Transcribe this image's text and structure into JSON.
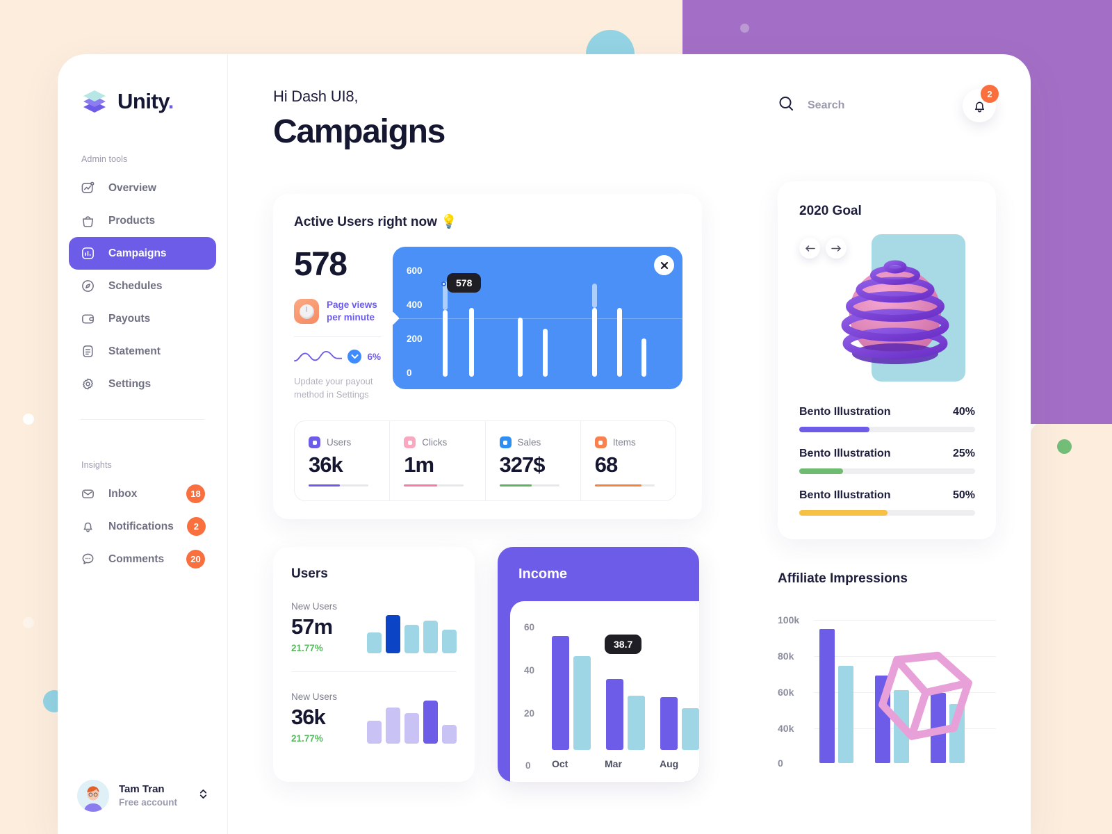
{
  "brand": {
    "name": "Unity",
    "dot": ".",
    "logo_icon": "layers-icon"
  },
  "sidebar": {
    "admin_label": "Admin tools",
    "insights_label": "Insights",
    "admin_items": [
      {
        "label": "Overview",
        "icon": "chart-square-icon"
      },
      {
        "label": "Products",
        "icon": "bag-icon"
      },
      {
        "label": "Campaigns",
        "icon": "bar-chart-icon"
      },
      {
        "label": "Schedules",
        "icon": "compass-icon"
      },
      {
        "label": "Payouts",
        "icon": "wallet-icon"
      },
      {
        "label": "Statement",
        "icon": "document-icon"
      },
      {
        "label": "Settings",
        "icon": "gear-icon"
      }
    ],
    "active_item": "Campaigns",
    "insight_items": [
      {
        "label": "Inbox",
        "icon": "envelope-icon",
        "badge": "18"
      },
      {
        "label": "Notifications",
        "icon": "bell-icon",
        "badge": "2"
      },
      {
        "label": "Comments",
        "icon": "comment-icon",
        "badge": "20"
      }
    ],
    "profile": {
      "name": "Tam Tran",
      "plan": "Free account",
      "switch_icon": "up-down-chevrons-icon"
    }
  },
  "header": {
    "greeting": "Hi Dash UI8,",
    "title": "Campaigns"
  },
  "topbar": {
    "search_placeholder": "Search",
    "search_icon": "search-icon",
    "bell_icon": "bell-icon",
    "bell_badge": "2"
  },
  "active_users": {
    "title": "Active Users right now 💡",
    "count": "578",
    "page_views_line1": "Page views",
    "page_views_line2": "per minute",
    "page_views_icon": "dial-icon",
    "trend_pct": "6%",
    "trend_icon": "chevron-down-circle-icon",
    "hint_line1": "Update your payout",
    "hint_line2": "method in Settings",
    "close_icon": "close-icon",
    "tooltip": "578"
  },
  "stats": [
    {
      "label": "Users",
      "value": "36k",
      "icon": "user-square-icon",
      "color": "#6c5ce7",
      "bar_color": "#6c5ce7",
      "bar_pct": 52
    },
    {
      "label": "Clicks",
      "value": "1m",
      "icon": "click-square-icon",
      "color": "#f9a8c0",
      "bar_color": "#f57aa4",
      "bar_pct": 55
    },
    {
      "label": "Sales",
      "value": "327$",
      "icon": "bag-square-icon",
      "color": "#2f8ff0",
      "bar_color": "#5cb35f",
      "bar_pct": 54
    },
    {
      "label": "Items",
      "value": "68",
      "icon": "box-square-icon",
      "color": "#f9804f",
      "bar_color": "#f4833f",
      "bar_pct": 78
    }
  ],
  "users_card": {
    "title": "Users",
    "blocks": [
      {
        "label": "New Users",
        "value": "57m",
        "pct": "21.77%"
      },
      {
        "label": "New Users",
        "value": "36k",
        "pct": "21.77%"
      }
    ]
  },
  "income_card": {
    "title": "Income",
    "tooltip": "38.7"
  },
  "goal_card": {
    "title": "2020 Goal",
    "prev_icon": "arrow-left-icon",
    "next_icon": "arrow-right-icon",
    "illustration_icon": "sphere-rings-3d-icon",
    "rows": [
      {
        "name": "Bento Illustration",
        "pct": "40%",
        "value": 40,
        "color": "#6c5ce7"
      },
      {
        "name": "Bento Illustration",
        "pct": "25%",
        "value": 25,
        "color": "#6fbb72"
      },
      {
        "name": "Bento Illustration",
        "pct": "50%",
        "value": 50,
        "color": "#f5c044"
      }
    ]
  },
  "affiliate": {
    "title": "Affiliate Impressions",
    "decor_icon": "wireframe-cube-3d-icon"
  },
  "chart_data": [
    {
      "type": "bar",
      "name": "active-users-sparkline",
      "title": "Active Users right now",
      "categories": [
        "1",
        "2",
        "3",
        "4",
        "5",
        "6",
        "7"
      ],
      "values": [
        390,
        400,
        345,
        280,
        400,
        400,
        220
      ],
      "highlight_index": 0,
      "highlight_value": 578,
      "ticks": [
        "600",
        "400",
        "200",
        "0"
      ],
      "ylim": [
        0,
        660
      ],
      "ylabel": "",
      "xlabel": "",
      "grid": true,
      "legend": "none",
      "bar_color": "#ffffff",
      "panel_color": "#4a90f7"
    },
    {
      "type": "bar",
      "name": "users-new-users-57m",
      "title": "New Users",
      "categories": [
        "1",
        "2",
        "3",
        "4",
        "5"
      ],
      "values": [
        30,
        55,
        41,
        47,
        34
      ],
      "highlight_index": 1,
      "colors": [
        "#9fd6e5",
        "#0b44c4",
        "#9fd6e5",
        "#9fd6e5",
        "#9fd6e5"
      ],
      "grid": false,
      "legend": "none"
    },
    {
      "type": "bar",
      "name": "users-new-users-36k",
      "title": "New Users",
      "categories": [
        "1",
        "2",
        "3",
        "4",
        "5"
      ],
      "values": [
        33,
        52,
        44,
        62,
        27
      ],
      "highlight_index": 3,
      "colors": [
        "#c9c2f5",
        "#c9c2f5",
        "#c9c2f5",
        "#6c5ce7",
        "#c9c2f5"
      ],
      "grid": false,
      "legend": "none"
    },
    {
      "type": "bar",
      "name": "income",
      "title": "Income",
      "categories": [
        "Oct",
        "Mar",
        "Aug"
      ],
      "series": [
        {
          "name": "primary",
          "values": [
            62,
            38.7,
            28
          ],
          "color": "#6c5ce7"
        },
        {
          "name": "secondary",
          "values": [
            51,
            29,
            22
          ],
          "color": "#9fd6e5"
        }
      ],
      "ticks": [
        "60",
        "40",
        "20",
        "0"
      ],
      "ylim": [
        0,
        70
      ],
      "ylabel": "",
      "xlabel": "",
      "annotation": "38.7",
      "grid": false,
      "legend": "none"
    },
    {
      "type": "bar",
      "name": "affiliate-impressions",
      "title": "Affiliate Impressions",
      "categories": [
        "1",
        "2",
        "3"
      ],
      "series": [
        {
          "name": "primary",
          "values": [
            95000,
            62000,
            50000
          ],
          "color": "#6c5ce7"
        },
        {
          "name": "secondary",
          "values": [
            69000,
            52000,
            42000
          ],
          "color": "#9fd6e5"
        }
      ],
      "ticks": [
        "100k",
        "80k",
        "60k",
        "40k",
        "0"
      ],
      "ylim": [
        0,
        110000
      ],
      "ylabel": "",
      "xlabel": "",
      "grid": true,
      "legend": "none"
    }
  ],
  "colors": {
    "accent": "#6c5ce7",
    "blue_panel": "#4a90f7",
    "orange_badge": "#f9703e",
    "cream_bg": "#fceddd",
    "purple_bg": "#a36fc6",
    "teal": "#93d3e3",
    "green": "#72bd77",
    "ink": "#15162f"
  }
}
